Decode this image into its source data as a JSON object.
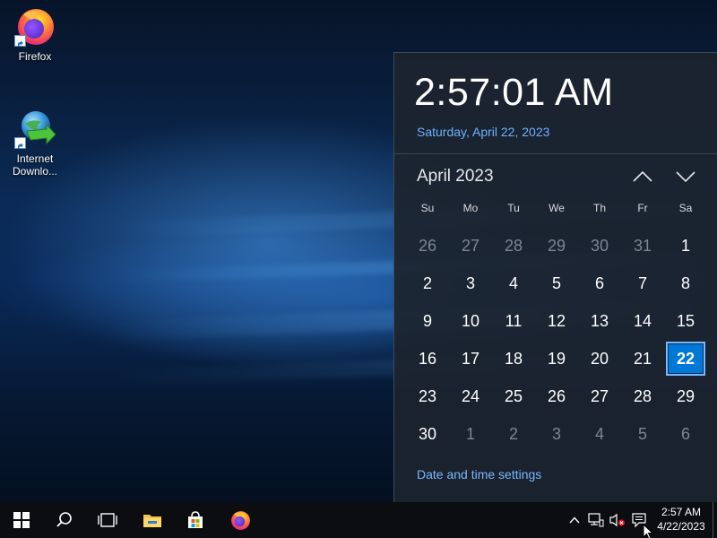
{
  "desktop": {
    "icons": [
      {
        "label": "Firefox",
        "icon": "firefox-icon"
      },
      {
        "label": "Internet Downlo...",
        "icon": "internet-download-manager-icon"
      }
    ]
  },
  "flyout": {
    "time": "2:57:01 AM",
    "date": "Saturday, April 22, 2023",
    "month_label": "April 2023",
    "weekdays": [
      "Su",
      "Mo",
      "Tu",
      "We",
      "Th",
      "Fr",
      "Sa"
    ],
    "days": [
      {
        "n": "26",
        "muted": true
      },
      {
        "n": "27",
        "muted": true
      },
      {
        "n": "28",
        "muted": true
      },
      {
        "n": "29",
        "muted": true
      },
      {
        "n": "30",
        "muted": true
      },
      {
        "n": "31",
        "muted": true
      },
      {
        "n": "1",
        "muted": false
      },
      {
        "n": "2",
        "muted": false
      },
      {
        "n": "3",
        "muted": false
      },
      {
        "n": "4",
        "muted": false
      },
      {
        "n": "5",
        "muted": false
      },
      {
        "n": "6",
        "muted": false
      },
      {
        "n": "7",
        "muted": false
      },
      {
        "n": "8",
        "muted": false
      },
      {
        "n": "9",
        "muted": false
      },
      {
        "n": "10",
        "muted": false
      },
      {
        "n": "11",
        "muted": false
      },
      {
        "n": "12",
        "muted": false
      },
      {
        "n": "13",
        "muted": false
      },
      {
        "n": "14",
        "muted": false
      },
      {
        "n": "15",
        "muted": false
      },
      {
        "n": "16",
        "muted": false
      },
      {
        "n": "17",
        "muted": false
      },
      {
        "n": "18",
        "muted": false
      },
      {
        "n": "19",
        "muted": false
      },
      {
        "n": "20",
        "muted": false
      },
      {
        "n": "21",
        "muted": false
      },
      {
        "n": "22",
        "muted": false,
        "today": true
      },
      {
        "n": "23",
        "muted": false
      },
      {
        "n": "24",
        "muted": false
      },
      {
        "n": "25",
        "muted": false
      },
      {
        "n": "26",
        "muted": false
      },
      {
        "n": "27",
        "muted": false
      },
      {
        "n": "28",
        "muted": false
      },
      {
        "n": "29",
        "muted": false
      },
      {
        "n": "30",
        "muted": false
      },
      {
        "n": "1",
        "muted": true
      },
      {
        "n": "2",
        "muted": true
      },
      {
        "n": "3",
        "muted": true
      },
      {
        "n": "4",
        "muted": true
      },
      {
        "n": "5",
        "muted": true
      },
      {
        "n": "6",
        "muted": true
      }
    ],
    "settings_link": "Date and time settings"
  },
  "taskbar": {
    "buttons": [
      "start-icon",
      "search-icon",
      "task-view-icon",
      "file-explorer-icon",
      "microsoft-store-icon",
      "firefox-icon"
    ],
    "tray_icons": [
      "chevron-up-icon",
      "network-icon",
      "volume-muted-icon",
      "notification-icon"
    ],
    "clock_time": "2:57 AM",
    "clock_date": "4/22/2023"
  },
  "colors": {
    "accent": "#0078d7",
    "link": "#7ab6ff",
    "flyout_bg": "#1c242e",
    "taskbar_bg": "#0b0d11"
  }
}
